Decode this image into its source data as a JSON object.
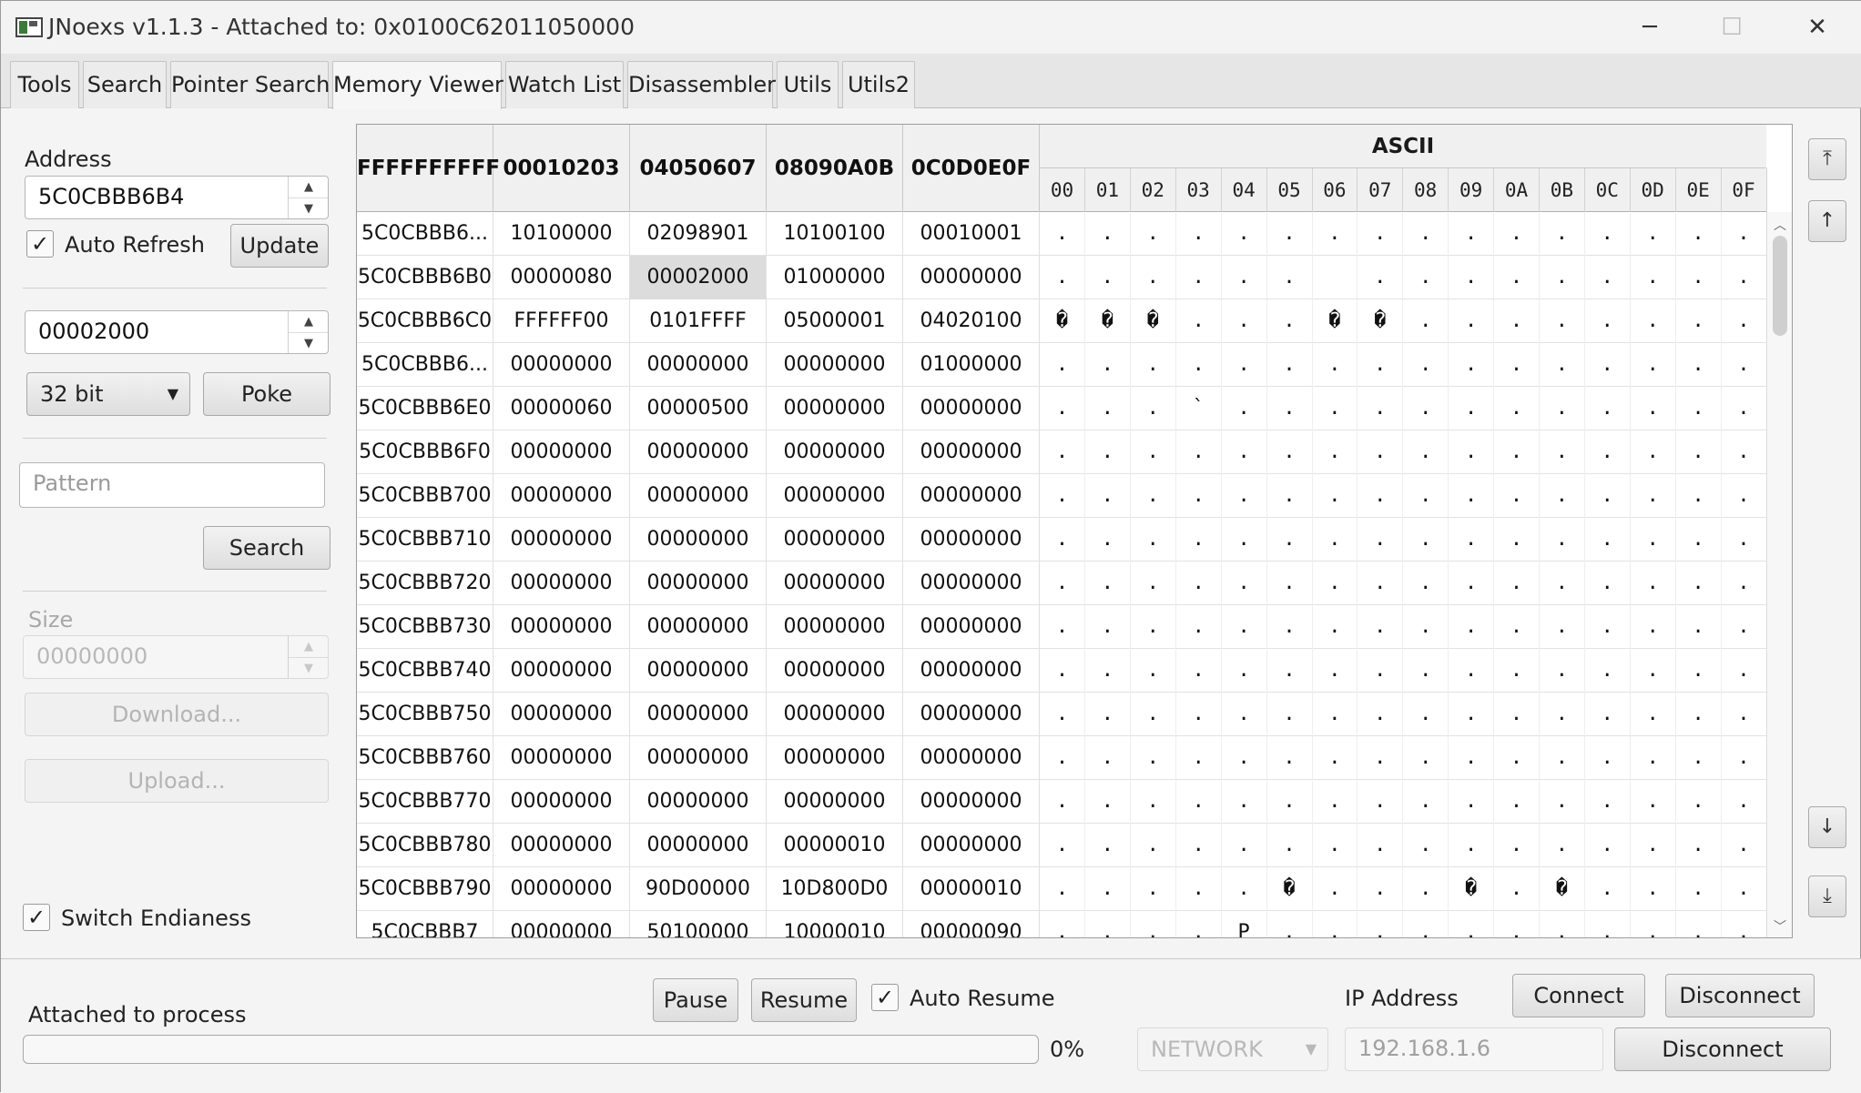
{
  "window": {
    "title": "JNoexs v1.1.3 - Attached to: 0x0100C62011050000",
    "minimize": "─",
    "maximize": "☐",
    "close": "✕"
  },
  "tabs": [
    "Tools",
    "Search",
    "Pointer Search",
    "Memory Viewer",
    "Watch List",
    "Disassembler",
    "Utils",
    "Utils2"
  ],
  "active_tab": "Memory Viewer",
  "left_panel": {
    "address_label": "Address",
    "address_value": "5C0CBBB6B4",
    "auto_refresh_label": "Auto Refresh",
    "auto_refresh_checked": "✓",
    "update_label": "Update",
    "poke_value": "00002000",
    "bit_select": "32 bit",
    "poke_label": "Poke",
    "pattern_placeholder": "Pattern",
    "search_label": "Search",
    "size_label": "Size",
    "size_value": "00000000",
    "download_label": "Download...",
    "upload_label": "Upload...",
    "switch_endianess_label": "Switch Endianess",
    "switch_endianess_checked": "✓"
  },
  "table": {
    "headers": [
      "FFFFFFFFFF",
      "00010203",
      "04050607",
      "08090A0B",
      "0C0D0E0F"
    ],
    "ascii_header": "ASCII",
    "ascii_columns": [
      "00",
      "01",
      "02",
      "03",
      "04",
      "05",
      "06",
      "07",
      "08",
      "09",
      "0A",
      "0B",
      "0C",
      "0D",
      "0E",
      "0F"
    ],
    "rows": [
      {
        "addr": "5C0CBBB6...",
        "c": [
          "10100000",
          "02098901",
          "10100100",
          "00010001"
        ],
        "ascii": [
          ".",
          ".",
          ".",
          ".",
          ".",
          ".",
          ".",
          ".",
          ".",
          ".",
          ".",
          ".",
          ".",
          ".",
          ".",
          "."
        ]
      },
      {
        "addr": "5C0CBBB6B0",
        "c": [
          "00000080",
          "00002000",
          "01000000",
          "00000000"
        ],
        "ascii": [
          ".",
          ".",
          ".",
          ".",
          ".",
          ".",
          "",
          ".",
          ".",
          ".",
          ".",
          ".",
          ".",
          ".",
          ".",
          "."
        ]
      },
      {
        "addr": "5C0CBBB6C0",
        "c": [
          "FFFFFF00",
          "0101FFFF",
          "05000001",
          "04020100"
        ],
        "ascii": [
          "�",
          "�",
          "�",
          ".",
          ".",
          ".",
          "�",
          "�",
          ".",
          ".",
          ".",
          ".",
          ".",
          ".",
          ".",
          "."
        ]
      },
      {
        "addr": "5C0CBBB6...",
        "c": [
          "00000000",
          "00000000",
          "00000000",
          "01000000"
        ],
        "ascii": [
          ".",
          ".",
          ".",
          ".",
          ".",
          ".",
          ".",
          ".",
          ".",
          ".",
          ".",
          ".",
          ".",
          ".",
          ".",
          "."
        ]
      },
      {
        "addr": "5C0CBBB6E0",
        "c": [
          "00000060",
          "00000500",
          "00000000",
          "00000000"
        ],
        "ascii": [
          ".",
          ".",
          ".",
          "`",
          ".",
          ".",
          ".",
          ".",
          ".",
          ".",
          ".",
          ".",
          ".",
          ".",
          ".",
          "."
        ]
      },
      {
        "addr": "5C0CBBB6F0",
        "c": [
          "00000000",
          "00000000",
          "00000000",
          "00000000"
        ],
        "ascii": [
          ".",
          ".",
          ".",
          ".",
          ".",
          ".",
          ".",
          ".",
          ".",
          ".",
          ".",
          ".",
          ".",
          ".",
          ".",
          "."
        ]
      },
      {
        "addr": "5C0CBBB700",
        "c": [
          "00000000",
          "00000000",
          "00000000",
          "00000000"
        ],
        "ascii": [
          ".",
          ".",
          ".",
          ".",
          ".",
          ".",
          ".",
          ".",
          ".",
          ".",
          ".",
          ".",
          ".",
          ".",
          ".",
          "."
        ]
      },
      {
        "addr": "5C0CBBB710",
        "c": [
          "00000000",
          "00000000",
          "00000000",
          "00000000"
        ],
        "ascii": [
          ".",
          ".",
          ".",
          ".",
          ".",
          ".",
          ".",
          ".",
          ".",
          ".",
          ".",
          ".",
          ".",
          ".",
          ".",
          "."
        ]
      },
      {
        "addr": "5C0CBBB720",
        "c": [
          "00000000",
          "00000000",
          "00000000",
          "00000000"
        ],
        "ascii": [
          ".",
          ".",
          ".",
          ".",
          ".",
          ".",
          ".",
          ".",
          ".",
          ".",
          ".",
          ".",
          ".",
          ".",
          ".",
          "."
        ]
      },
      {
        "addr": "5C0CBBB730",
        "c": [
          "00000000",
          "00000000",
          "00000000",
          "00000000"
        ],
        "ascii": [
          ".",
          ".",
          ".",
          ".",
          ".",
          ".",
          ".",
          ".",
          ".",
          ".",
          ".",
          ".",
          ".",
          ".",
          ".",
          "."
        ]
      },
      {
        "addr": "5C0CBBB740",
        "c": [
          "00000000",
          "00000000",
          "00000000",
          "00000000"
        ],
        "ascii": [
          ".",
          ".",
          ".",
          ".",
          ".",
          ".",
          ".",
          ".",
          ".",
          ".",
          ".",
          ".",
          ".",
          ".",
          ".",
          "."
        ]
      },
      {
        "addr": "5C0CBBB750",
        "c": [
          "00000000",
          "00000000",
          "00000000",
          "00000000"
        ],
        "ascii": [
          ".",
          ".",
          ".",
          ".",
          ".",
          ".",
          ".",
          ".",
          ".",
          ".",
          ".",
          ".",
          ".",
          ".",
          ".",
          "."
        ]
      },
      {
        "addr": "5C0CBBB760",
        "c": [
          "00000000",
          "00000000",
          "00000000",
          "00000000"
        ],
        "ascii": [
          ".",
          ".",
          ".",
          ".",
          ".",
          ".",
          ".",
          ".",
          ".",
          ".",
          ".",
          ".",
          ".",
          ".",
          ".",
          "."
        ]
      },
      {
        "addr": "5C0CBBB770",
        "c": [
          "00000000",
          "00000000",
          "00000000",
          "00000000"
        ],
        "ascii": [
          ".",
          ".",
          ".",
          ".",
          ".",
          ".",
          ".",
          ".",
          ".",
          ".",
          ".",
          ".",
          ".",
          ".",
          ".",
          "."
        ]
      },
      {
        "addr": "5C0CBBB780",
        "c": [
          "00000000",
          "00000000",
          "00000010",
          "00000000"
        ],
        "ascii": [
          ".",
          ".",
          ".",
          ".",
          ".",
          ".",
          ".",
          ".",
          ".",
          ".",
          ".",
          ".",
          ".",
          ".",
          ".",
          "."
        ]
      },
      {
        "addr": "5C0CBBB790",
        "c": [
          "00000000",
          "90D00000",
          "10D800D0",
          "00000010"
        ],
        "ascii": [
          ".",
          ".",
          ".",
          ".",
          ".",
          "�",
          ".",
          ".",
          ".",
          "�",
          ".",
          "�",
          ".",
          ".",
          ".",
          "."
        ]
      },
      {
        "addr": "5C0CBBB7",
        "c": [
          "00000000",
          "50100000",
          "10000010",
          "00000090"
        ],
        "ascii": [
          ".",
          ".",
          ".",
          ".",
          "P",
          ".",
          ".",
          ".",
          ".",
          ".",
          ".",
          ".",
          ".",
          ".",
          ".",
          "."
        ]
      }
    ]
  },
  "nav_buttons": [
    "⤒",
    "↑",
    "↓",
    "⤓"
  ],
  "bottom": {
    "status": "Attached to process",
    "progress_percent": "0%",
    "progress_fraction": 0,
    "pause_label": "Pause",
    "resume_label": "Resume",
    "auto_resume_label": "Auto Resume",
    "auto_resume_checked": "✓",
    "connection_type": "NETWORK",
    "ip_label": "IP Address",
    "ip_value": "192.168.1.6",
    "connect_label": "Connect",
    "disconnect_label": "Disconnect",
    "disconnect2_label": "Disconnect"
  },
  "colors": {
    "accent": "#3a7bd5",
    "selected_cell": "#dcdcdc"
  }
}
